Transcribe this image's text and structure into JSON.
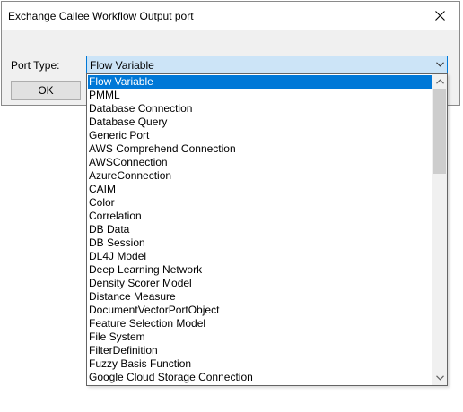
{
  "window": {
    "title": "Exchange Callee Workflow Output port",
    "close_icon": "close-icon"
  },
  "form": {
    "port_type_label": "Port Type:",
    "selected_value": "Flow Variable",
    "ok_label": "OK"
  },
  "dropdown": {
    "selected_index": 0,
    "items": [
      "Flow Variable",
      "PMML",
      "Database Connection",
      "Database Query",
      "Generic Port",
      "AWS Comprehend Connection",
      "AWSConnection",
      "AzureConnection",
      "CAIM",
      "Color",
      "Correlation",
      "DB Data",
      "DB Session",
      "DL4J Model",
      "Deep Learning Network",
      "Density Scorer Model",
      "Distance Measure",
      "DocumentVectorPortObject",
      "Feature Selection Model",
      "File System",
      "FilterDefinition",
      "Fuzzy Basis Function",
      "Google Cloud Storage Connection"
    ],
    "scroll_position": 0.0,
    "visible_fraction": 0.3
  },
  "colors": {
    "accent": "#0078d7",
    "combo_background": "#cce4f7",
    "dialog_background": "#f0f0f0"
  }
}
